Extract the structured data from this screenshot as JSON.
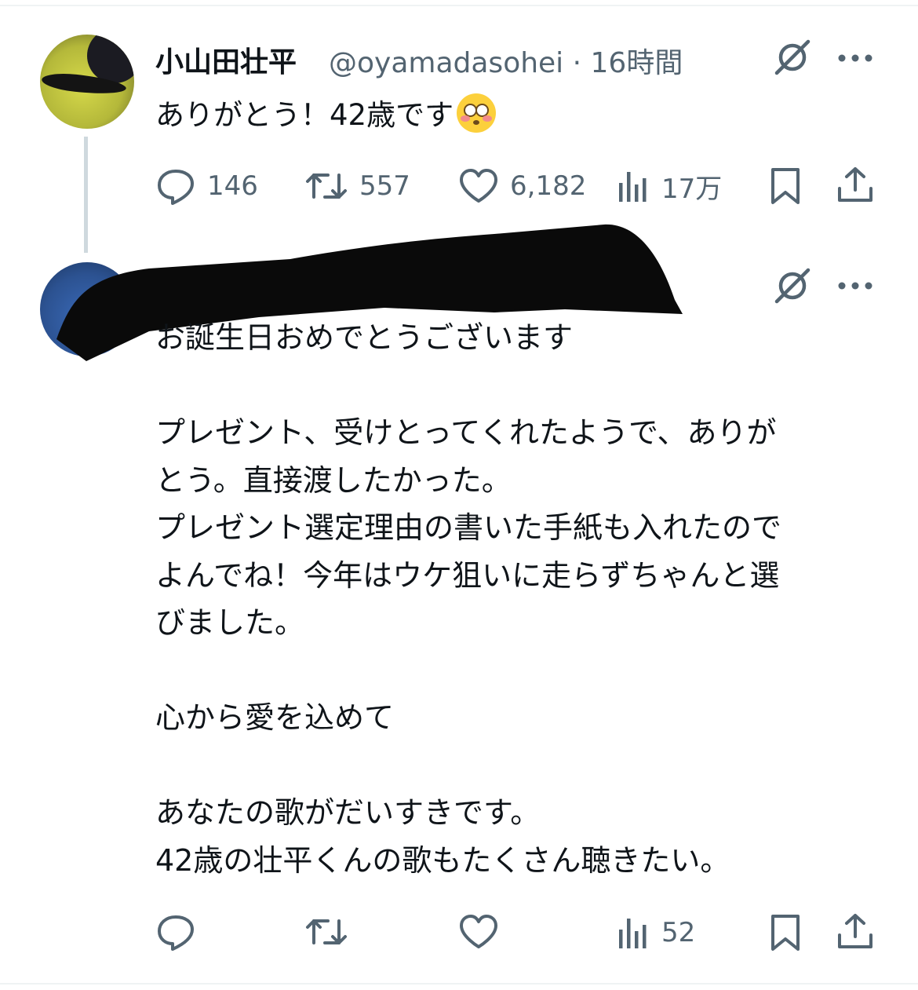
{
  "tweet": {
    "author_name": "小山田壮平",
    "handle_time": "@oyamadasohei · 16時間",
    "text": "ありがとう！42歳です",
    "emoji": "flushed-face-emoji",
    "metrics": {
      "replies": "146",
      "reposts": "557",
      "likes": "6,182",
      "views": "17万"
    }
  },
  "reply": {
    "author_redacted": true,
    "paragraphs": [
      [
        "お誕生日おめでとうございます"
      ],
      [
        "プレゼント、受けとってくれたようで、ありが",
        "とう。直接渡したかった。",
        "プレゼント選定理由の書いた手紙も入れたので",
        "よんでね！今年はウケ狙いに走らずちゃんと選",
        "びました。"
      ],
      [
        "心から愛を込めて"
      ],
      [
        "あなたの歌がだいすきです。",
        "42歳の壮平くんの歌もたくさん聴きたい。"
      ]
    ],
    "metrics": {
      "views": "52"
    }
  },
  "icons": {
    "reply": "reply-icon",
    "repost": "repost-icon",
    "like": "heart-icon",
    "views": "views-icon",
    "bookmark": "bookmark-icon",
    "share": "share-icon",
    "grok": "grok-icon",
    "more": "more-icon"
  },
  "colors": {
    "text": "#0f1419",
    "secondary": "#536471",
    "thread_line": "#cfd9de"
  }
}
